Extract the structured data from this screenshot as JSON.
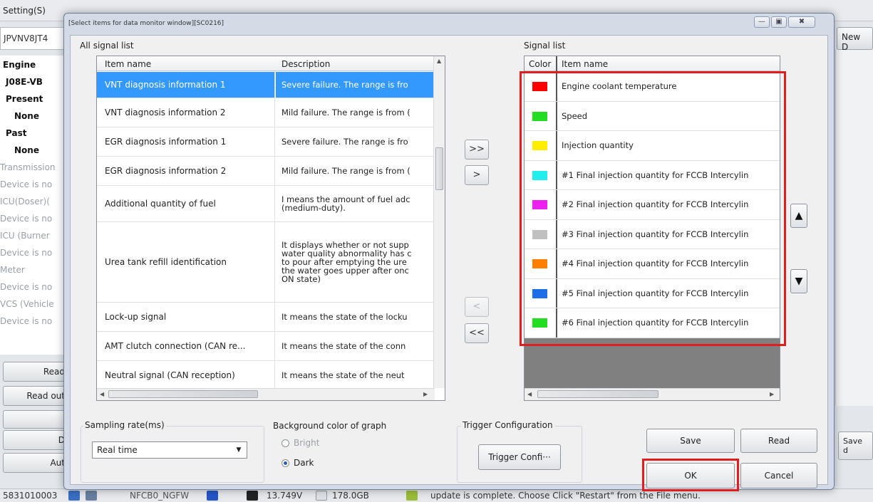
{
  "background_app": {
    "menu_label": "Setting(S)",
    "vin_fragment": "JPVNV8JT4",
    "new_button": "New D",
    "tree": [
      {
        "label": "Engine",
        "style": "b"
      },
      {
        "label": "J08E-VB",
        "style": "b"
      },
      {
        "label": "Present",
        "style": "b"
      },
      {
        "label": "None",
        "style": "b"
      },
      {
        "label": "Past",
        "style": "b"
      },
      {
        "label": "None",
        "style": "b"
      },
      {
        "label": "Transmission",
        "style": "g"
      },
      {
        "label": "Device is no",
        "style": "g"
      },
      {
        "label": "ICU(Doser)(",
        "style": "g"
      },
      {
        "label": "Device is no",
        "style": "g"
      },
      {
        "label": "ICU (Burner",
        "style": "g"
      },
      {
        "label": "Device is no",
        "style": "g"
      },
      {
        "label": "Meter",
        "style": "g"
      },
      {
        "label": "Device is no",
        "style": "g"
      },
      {
        "label": "VCS (Vehicle",
        "style": "g"
      },
      {
        "label": "Device is no",
        "style": "g"
      }
    ],
    "left_buttons": [
      "Read",
      "Read out",
      "",
      "D",
      "Aut"
    ],
    "right_button": "Save d",
    "status": {
      "id": "5831010003",
      "nfcb": "NFCB0_NGFW",
      "voltage": "13.749V",
      "disk": "178.0GB",
      "message": "update is complete. Choose Click \"Restart\" from the File menu."
    }
  },
  "dialog": {
    "title": "[Select items for data monitor window][SC0216]",
    "window_buttons": [
      "—",
      "▣",
      "✖"
    ],
    "all_signal_list": {
      "label": "All signal list",
      "columns": [
        "Item name",
        "Description"
      ],
      "rows": [
        {
          "name": "VNT diagnosis information 1",
          "desc": "Severe failure. The range is fro",
          "selected": true
        },
        {
          "name": "VNT diagnosis information 2",
          "desc": "Mild failure. The range is from (",
          "selected": false
        },
        {
          "name": "EGR diagnosis information 1",
          "desc": "Severe failure. The range is fro",
          "selected": false
        },
        {
          "name": "EGR diagnosis information 2",
          "desc": "Mild failure. The range is from (",
          "selected": false
        },
        {
          "name": "Additional quantity of fuel",
          "desc": "I means the amount of fuel adc\n(medium-duty).",
          "selected": false
        },
        {
          "name": "Urea tank refill identification",
          "desc": "It displays whether or not supp\nwater quality abnormality has c\nto pour after emptying the ure\nthe water goes upper after onc\nON state)",
          "selected": false
        },
        {
          "name": "Lock-up signal",
          "desc": "It means the state of the locku",
          "selected": false
        },
        {
          "name": "AMT clutch connection (CAN re...",
          "desc": "It means the state of the conn",
          "selected": false
        },
        {
          "name": "Neutral signal (CAN reception)",
          "desc": "It means the state of the neut",
          "selected": false
        }
      ]
    },
    "transfer_buttons": {
      "add_all": ">>",
      "add": ">",
      "remove": "<",
      "remove_all": "<<"
    },
    "signal_list": {
      "label": "Signal list",
      "columns": [
        "Color",
        "Item name"
      ],
      "rows": [
        {
          "color": "#ff0000",
          "name": "Engine coolant temperature"
        },
        {
          "color": "#22dd22",
          "name": "Speed"
        },
        {
          "color": "#ffee00",
          "name": "Injection quantity"
        },
        {
          "color": "#22eeee",
          "name": "#1 Final injection quantity for FCCB Intercylin"
        },
        {
          "color": "#ee22ee",
          "name": "#2 Final injection quantity for FCCB Intercylin"
        },
        {
          "color": "#c0c0c0",
          "name": "#3 Final injection quantity for FCCB Intercylin"
        },
        {
          "color": "#ff8000",
          "name": "#4 Final injection quantity for FCCB Intercylin"
        },
        {
          "color": "#1e6ee8",
          "name": "#5 Final injection quantity for FCCB Intercylin"
        },
        {
          "color": "#22dd22",
          "name": "#6 Final injection quantity for FCCB Intercylin"
        }
      ]
    },
    "order_buttons": {
      "up": "▲",
      "down": "▼"
    },
    "sampling": {
      "label": "Sampling rate(ms)",
      "value": "Real time"
    },
    "background_color": {
      "label": "Background color of graph",
      "options": [
        "Bright",
        "Dark"
      ],
      "selected": "Dark"
    },
    "trigger": {
      "label": "Trigger Configuration",
      "button": "Trigger Confi···"
    },
    "actions": {
      "save": "Save",
      "read": "Read",
      "ok": "OK",
      "cancel": "Cancel"
    },
    "highlight_color": "#e01e1e"
  }
}
